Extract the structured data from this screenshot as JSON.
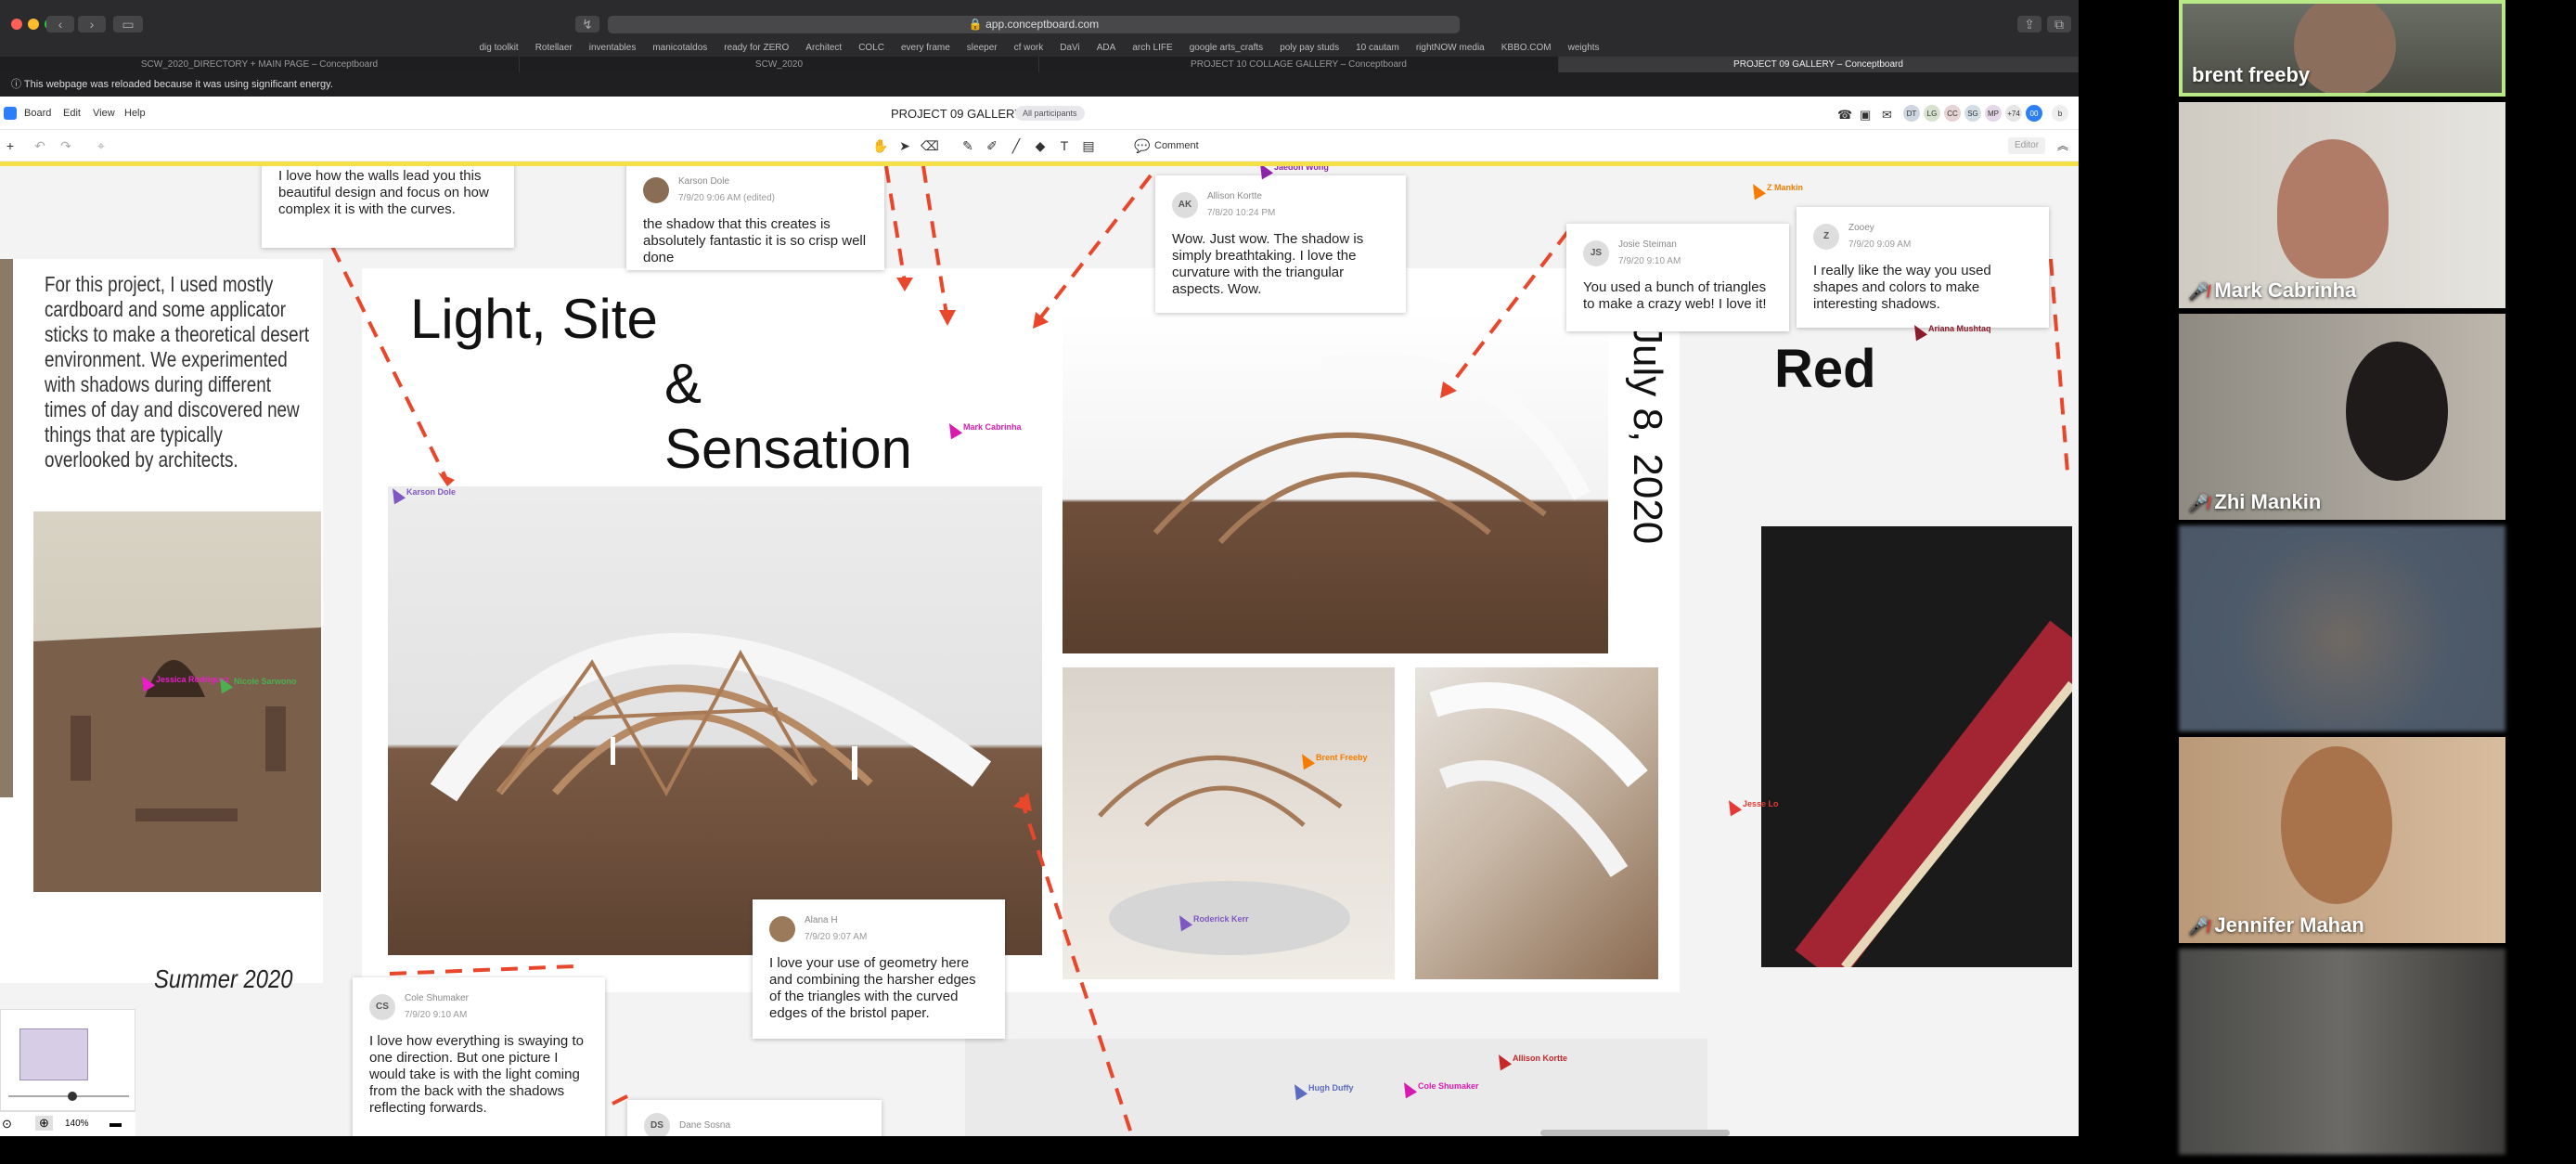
{
  "browser": {
    "url": "app.conceptboard.com",
    "bookmarks": [
      "dig toolkit",
      "Rotellaer",
      "inventables",
      "manicotaldos",
      "ready for ZERO",
      "Architect",
      "COLC",
      "every frame",
      "sleeper",
      "cf work",
      "DaVi",
      "ADA",
      "arch LIFE",
      "google arts_crafts",
      "poly pay studs",
      "10 cautam",
      "rightNOW media",
      "KBBO.COM",
      "weights"
    ],
    "tabs": [
      {
        "label": "SCW_2020_DIRECTORY + MAIN PAGE – Conceptboard",
        "active": false
      },
      {
        "label": "SCW_2020",
        "active": false
      },
      {
        "label": "PROJECT 10 COLLAGE GALLERY – Conceptboard",
        "active": false
      },
      {
        "label": "PROJECT 09 GALLERY – Conceptboard",
        "active": true
      }
    ],
    "notice": "This webpage was reloaded because it was using significant energy."
  },
  "app": {
    "menu": [
      "Board",
      "Edit",
      "View",
      "Help"
    ],
    "board_title": "PROJECT 09 GALLERY",
    "participants_label": "All participants",
    "avatars": [
      "DT",
      "LG",
      "CC",
      "SG",
      "MP",
      "+74",
      "00"
    ],
    "user_initial": "b",
    "comment_tool_label": "Comment",
    "editor_label": "Editor",
    "zoom": "140%"
  },
  "board": {
    "left_text": "For this project, I used mostly cardboard and some applicator sticks to make a theoretical desert environment. We experimented with shadows during different times of day and discovered new things that are typically overlooked by architects.",
    "summer": "Summer 2020",
    "title_line1": "Light, Site",
    "title_line2": "&",
    "title_line3": "Sensation",
    "date_vertical": "July 8, 2020",
    "red_title": "Red"
  },
  "comments": [
    {
      "id": "top-partial",
      "name": "",
      "date": "",
      "initials": "",
      "text": "I love how the walls lead you this beautiful design and focus on how complex it is with the curves."
    },
    {
      "id": "karson",
      "name": "Karson Dole",
      "date": "7/9/20 9:06 AM (edited)",
      "initials": "",
      "text": "the shadow that this creates is absolutely fantastic  it is so crisp well done"
    },
    {
      "id": "allison",
      "name": "Allison Kortte",
      "date": "7/8/20 10:24 PM",
      "initials": "AK",
      "text": "Wow. Just wow. The shadow is simply breathtaking. I love the curvature with the triangular aspects. Wow."
    },
    {
      "id": "josie",
      "name": "Josie Steiman",
      "date": "7/9/20 9:10 AM",
      "initials": "JS",
      "text": "You used a bunch of triangles to make a crazy web! I love it!"
    },
    {
      "id": "zooey",
      "name": "Zooey",
      "date": "7/9/20 9:09 AM",
      "initials": "Z",
      "text": "I really like the way you used shapes and colors to make interesting shadows."
    },
    {
      "id": "alana",
      "name": "Alana H",
      "date": "7/9/20 9:07 AM",
      "initials": "",
      "text": "I love your use of geometry here and combining the harsher edges of the triangles with the curved edges of the bristol paper."
    },
    {
      "id": "cole",
      "name": "Cole Shumaker",
      "date": "7/9/20 9:10 AM",
      "initials": "CS",
      "text": "I love how everything is swaying to one direction. But one picture I would take is with the light coming from the back with the shadows reflecting forwards."
    },
    {
      "id": "dane",
      "name": "Dane Sosna",
      "date": "",
      "initials": "DS",
      "text": ""
    }
  ],
  "cursors": [
    {
      "name": "Jaedon Wong",
      "color": "#8e24aa"
    },
    {
      "name": "Z Mankin",
      "color": "#f57c00"
    },
    {
      "name": "Ariana Mushtaq",
      "color": "#8b1a2b"
    },
    {
      "name": "Mark Cabrinha",
      "color": "#d81bb0"
    },
    {
      "name": "Karson Dole",
      "color": "#7e57c2"
    },
    {
      "name": "Jessica Rodriguez",
      "color": "#e91ec8"
    },
    {
      "name": "Nicole Sarwono",
      "color": "#4caf50"
    },
    {
      "name": "Brent Freeby",
      "color": "#f57c00"
    },
    {
      "name": "Jesse Lo",
      "color": "#e53935"
    },
    {
      "name": "Roderick Kerr",
      "color": "#7e57c2"
    },
    {
      "name": "Allison Kortte",
      "color": "#c62828"
    },
    {
      "name": "Cole Shumaker",
      "color": "#d81bb0"
    },
    {
      "name": "Hugh Duffy",
      "color": "#5c6bc0"
    }
  ],
  "zoom_gallery": [
    {
      "name": "brent freeby",
      "muted": false,
      "active": true
    },
    {
      "name": "Mark Cabrinha",
      "muted": true,
      "active": false
    },
    {
      "name": "Zhi Mankin",
      "muted": true,
      "active": false
    },
    {
      "name": "",
      "muted": false,
      "active": false
    },
    {
      "name": "Jennifer Mahan",
      "muted": true,
      "active": false
    },
    {
      "name": "",
      "muted": false,
      "active": false
    }
  ],
  "colors": {
    "accent_yellow": "#f5e04a",
    "arrow_red": "#e8472c",
    "active_speaker": "#b8e986"
  }
}
